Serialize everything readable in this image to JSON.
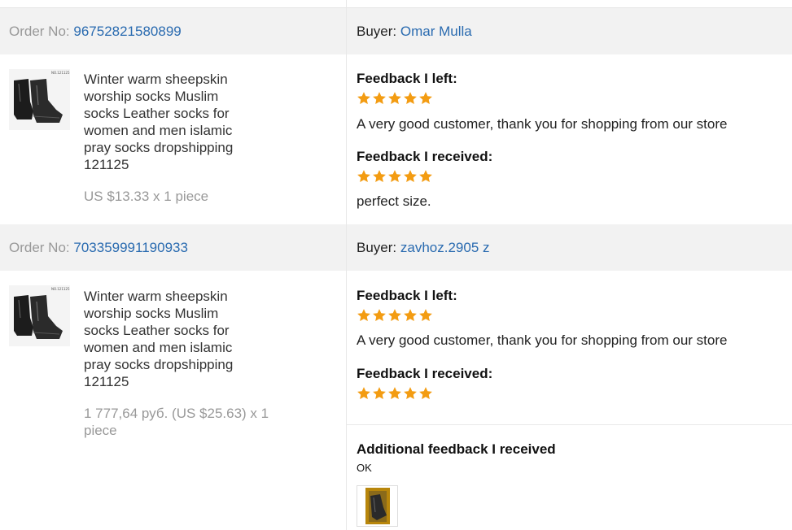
{
  "orders": [
    {
      "order_label": "Order No:",
      "order_number": "96752821580899",
      "buyer_label": "Buyer:",
      "buyer_name": "Omar Mulla",
      "product_title": "Winter warm sheepskin worship socks Muslim socks Leather socks for women and men islamic pray socks dropshipping 121125",
      "thumb_code": "NO.121125",
      "price": "US $13.33 x 1 piece",
      "feedback_left_label": "Feedback I left:",
      "feedback_left_rating": 5,
      "feedback_left_text": "A very good customer, thank you for shopping from our store",
      "feedback_received_label": "Feedback I received:",
      "feedback_received_rating": 5,
      "feedback_received_text": "perfect size."
    },
    {
      "order_label": "Order No:",
      "order_number": "703359991190933",
      "buyer_label": "Buyer:",
      "buyer_name": "zavhoz.2905 z",
      "product_title": "Winter warm sheepskin worship socks Muslim socks Leather socks for women and men islamic pray socks dropshipping 121125",
      "thumb_code": "NO.121125",
      "price": "1 777,64 руб. (US $25.63) x 1 piece",
      "feedback_left_label": "Feedback I left:",
      "feedback_left_rating": 5,
      "feedback_left_text": "A very good customer, thank you for shopping from our store",
      "feedback_received_label": "Feedback I received:",
      "feedback_received_rating": 5,
      "additional_feedback_label": "Additional feedback I received",
      "additional_feedback_text": "OK"
    }
  ],
  "colors": {
    "link": "#2a6bb0",
    "star": "#f39c12",
    "header_bg": "#f2f2f2",
    "muted": "#999999"
  },
  "icons": {
    "star": "star-icon",
    "product_thumb": "sock-product-image",
    "buyer_photo": "buyer-photo-thumbnail"
  }
}
